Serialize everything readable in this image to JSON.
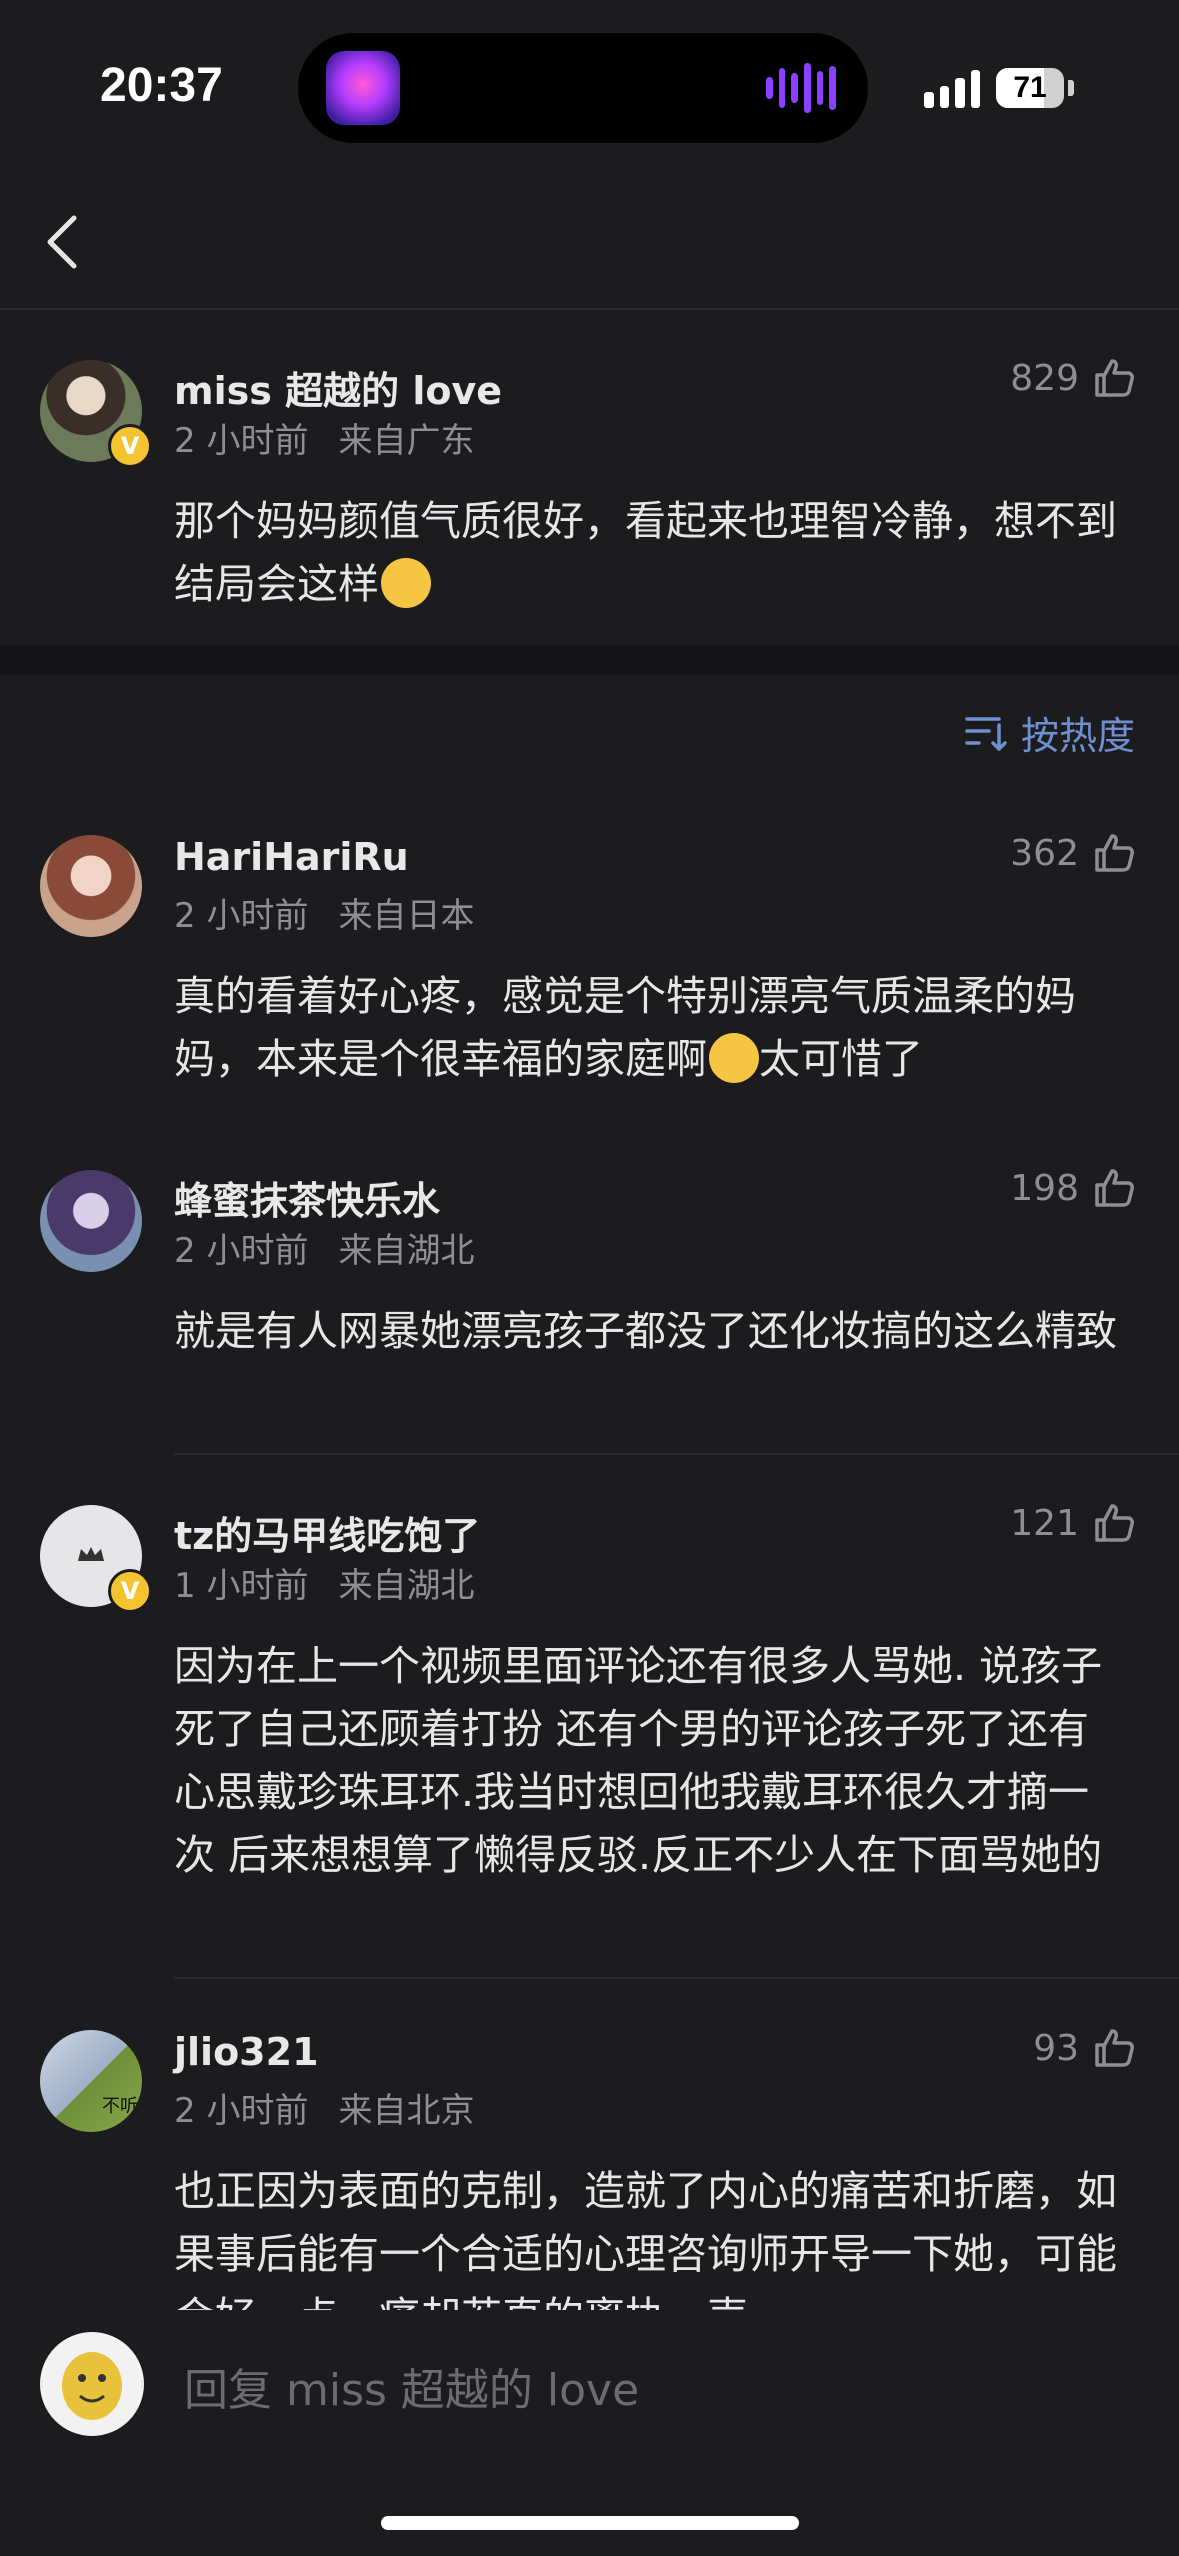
{
  "status_bar": {
    "time": "20:37",
    "battery": "71"
  },
  "main_comment": {
    "username": "miss 超越的 love",
    "time": "2 小时前",
    "location": "来自广东",
    "likes": "829",
    "text": "那个妈妈颜值气质很好，看起来也理智冷静，想不到结局会这样",
    "emoji": "face-with-tears-icon"
  },
  "sort": {
    "label": "按热度"
  },
  "comments": [
    {
      "username": "HariHariRu",
      "time": "2 小时前",
      "location": "来自日本",
      "likes": "362",
      "text_a": "真的看着好心疼，感觉是个特别漂亮气质温柔的妈妈，本来是个很幸福的家庭啊",
      "text_b": "太可惜了"
    },
    {
      "username": "蜂蜜抹茶快乐水",
      "time": "2 小时前",
      "location": "来自湖北",
      "likes": "198",
      "text": "就是有人网暴她漂亮孩子都没了还化妆搞的这么精致"
    },
    {
      "username": "tz的马甲线吃饱了",
      "time": "1 小时前",
      "location": "来自湖北",
      "likes": "121",
      "text": "因为在上一个视频里面评论还有很多人骂她. 说孩子死了自己还顾着打扮 还有个男的评论孩子死了还有心思戴珍珠耳环.我当时想回他我戴耳环很久才摘一次 后来想想算了懒得反驳.反正不少人在下面骂她的"
    },
    {
      "username": "jlio321",
      "time": "2 小时前",
      "location": "来自北京",
      "likes": "93",
      "avatar_text": "不听",
      "text": "也正因为表面的克制，造就了内心的痛苦和折磨，如果事后能有一个合适的心理咨询师开导一下她，可能会好一点，痛却若直的离执，声"
    }
  ],
  "reply": {
    "placeholder": "回复 miss 超越的 love"
  }
}
